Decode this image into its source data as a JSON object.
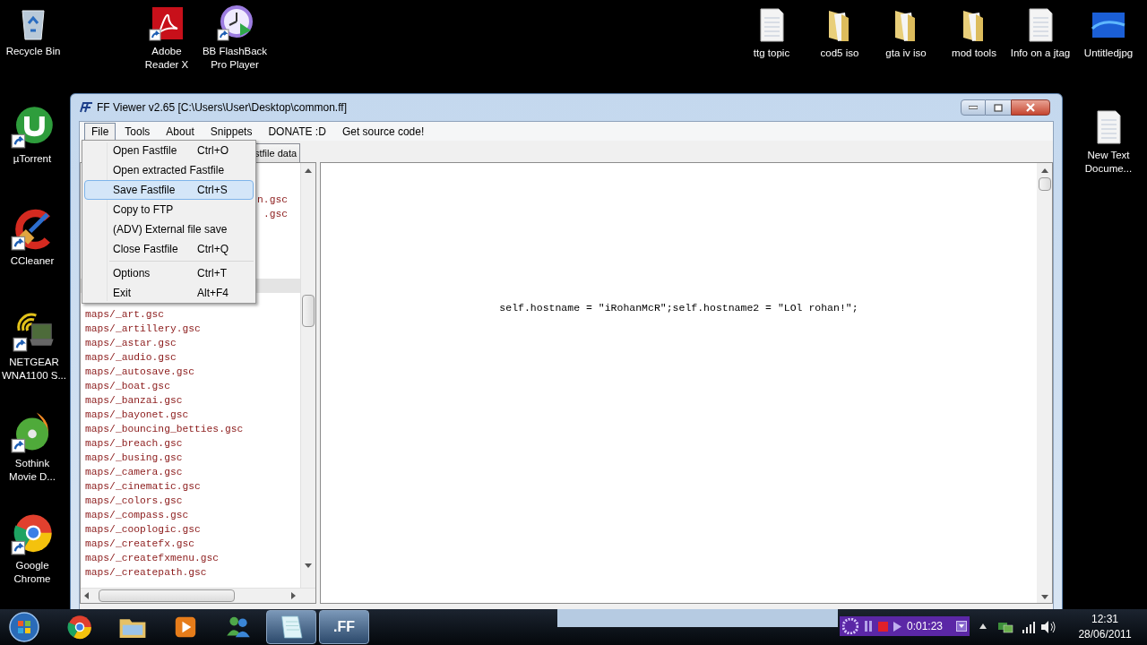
{
  "desktop": {
    "top_left": [
      {
        "label": "Recycle Bin",
        "kind": "recycle"
      },
      {
        "label": "Adobe Reader X",
        "kind": "pdf"
      },
      {
        "label": "BB FlashBack Pro Player",
        "kind": "clock"
      }
    ],
    "top_right": [
      {
        "label": "ttg topic",
        "kind": "doc"
      },
      {
        "label": "cod5 iso",
        "kind": "folder"
      },
      {
        "label": "gta iv iso",
        "kind": "folder"
      },
      {
        "label": "mod tools",
        "kind": "folder"
      },
      {
        "label": "Info on a jtag",
        "kind": "doc"
      },
      {
        "label": "Untitledjpg",
        "kind": "image"
      }
    ],
    "left_column": [
      {
        "label": "µTorrent",
        "kind": "utorrent"
      },
      {
        "label": "CCleaner",
        "kind": "ccleaner"
      },
      {
        "label": "NETGEAR WNA1100 S...",
        "kind": "netgear"
      },
      {
        "label": "Sothink Movie D...",
        "kind": "dvd"
      },
      {
        "label": "Google Chrome",
        "kind": "chrome"
      }
    ],
    "right_column": [
      {
        "label": "New Text Docume...",
        "kind": "doc"
      }
    ]
  },
  "window": {
    "title": "FF Viewer v2.65 [C:\\Users\\User\\Desktop\\common.ff]",
    "menu_bar": [
      {
        "label": "File",
        "selected": true
      },
      {
        "label": "Tools",
        "selected": false
      },
      {
        "label": "About",
        "selected": false
      },
      {
        "label": "Snippets",
        "selected": false
      },
      {
        "label": "DONATE :D",
        "selected": false
      },
      {
        "label": "Get source code!",
        "selected": false
      }
    ],
    "file_menu": [
      {
        "kind": "item",
        "label": "Open Fastfile",
        "shortcut": "Ctrl+O",
        "selected": false
      },
      {
        "kind": "item",
        "label": "Open extracted Fastfile",
        "selected": false
      },
      {
        "kind": "item",
        "label": "Save Fastfile",
        "shortcut": "Ctrl+S",
        "selected": true
      },
      {
        "kind": "item",
        "label": "Copy to FTP",
        "selected": false
      },
      {
        "kind": "item",
        "label": "(ADV) External file save",
        "selected": false
      },
      {
        "kind": "item",
        "label": "Close Fastfile",
        "shortcut": "Ctrl+Q",
        "selected": false
      },
      {
        "kind": "separator"
      },
      {
        "kind": "item",
        "label": "Options",
        "shortcut": "Ctrl+T",
        "selected": false
      },
      {
        "kind": "item",
        "label": "Exit",
        "shortcut": "Alt+F4",
        "selected": false
      }
    ],
    "tab": {
      "label": "stfile data"
    },
    "file_list": {
      "fragments": [
        "n.gsc",
        ".gsc"
      ],
      "items": [
        "maps/_art.gsc",
        "maps/_artillery.gsc",
        "maps/_astar.gsc",
        "maps/_audio.gsc",
        "maps/_autosave.gsc",
        "maps/_boat.gsc",
        "maps/_banzai.gsc",
        "maps/_bayonet.gsc",
        "maps/_bouncing_betties.gsc",
        "maps/_breach.gsc",
        "maps/_busing.gsc",
        "maps/_camera.gsc",
        "maps/_cinematic.gsc",
        "maps/_colors.gsc",
        "maps/_compass.gsc",
        "maps/_cooplogic.gsc",
        "maps/_createfx.gsc",
        "maps/_createfxmenu.gsc",
        "maps/_createpath.gsc"
      ]
    },
    "editor_text": "self.hostname = \"iRohanMcR\";self.hostname2 = \"LOl rohan!\";"
  },
  "taskbar": {
    "buttons": [
      {
        "kind": "chrome",
        "active": false
      },
      {
        "kind": "explorer",
        "active": false
      },
      {
        "kind": "media",
        "active": false
      },
      {
        "kind": "messenger",
        "active": false
      },
      {
        "kind": "notepad",
        "active": true
      },
      {
        "kind": "text",
        "label": ".FF",
        "active": true
      }
    ],
    "recorder": {
      "time": "0:01:23"
    },
    "clock": {
      "time": "12:31",
      "date": "28/06/2011"
    }
  }
}
